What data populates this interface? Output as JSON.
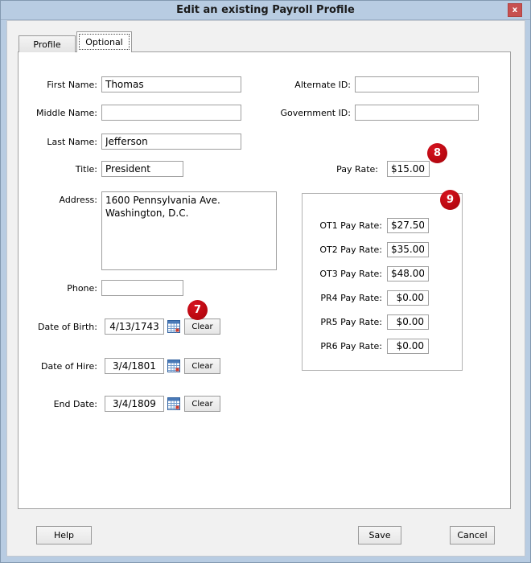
{
  "window": {
    "title": "Edit an existing Payroll Profile",
    "close_label": "x"
  },
  "tabs": {
    "profile": "Profile",
    "optional": "Optional"
  },
  "form": {
    "first_name": {
      "label": "First Name:",
      "value": "Thomas"
    },
    "middle_name": {
      "label": "Middle Name:",
      "value": ""
    },
    "last_name": {
      "label": "Last Name:",
      "value": "Jefferson"
    },
    "job_title": {
      "label": "Title:",
      "value": "President"
    },
    "address": {
      "label": "Address:",
      "value": "1600 Pennsylvania Ave.\nWashington, D.C."
    },
    "phone": {
      "label": "Phone:",
      "value": ""
    },
    "date_of_birth": {
      "label": "Date of Birth:",
      "value": "4/13/1743",
      "clear": "Clear"
    },
    "date_of_hire": {
      "label": "Date of Hire:",
      "value": "3/4/1801",
      "clear": "Clear"
    },
    "end_date": {
      "label": "End Date:",
      "value": "3/4/1809",
      "clear": "Clear"
    },
    "alternate_id": {
      "label": "Alternate ID:",
      "value": ""
    },
    "government_id": {
      "label": "Government ID:",
      "value": ""
    },
    "pay_rate": {
      "label": "Pay Rate:",
      "value": "$15.00"
    },
    "rates": [
      {
        "label": "OT1 Pay Rate:",
        "value": "$27.50"
      },
      {
        "label": "OT2 Pay Rate:",
        "value": "$35.00"
      },
      {
        "label": "OT3 Pay Rate:",
        "value": "$48.00"
      },
      {
        "label": "PR4 Pay Rate:",
        "value": "$0.00"
      },
      {
        "label": "PR5 Pay Rate:",
        "value": "$0.00"
      },
      {
        "label": "PR6 Pay Rate:",
        "value": "$0.00"
      }
    ]
  },
  "annotations": {
    "badge_7": "7",
    "badge_8": "8",
    "badge_9": "9"
  },
  "buttons": {
    "help": "Help",
    "save": "Save",
    "cancel": "Cancel"
  },
  "colors": {
    "titlebar": "#b8cce2",
    "close_red": "#c75050",
    "badge_red": "#bb0811",
    "panel_border": "#a0a0a0"
  }
}
